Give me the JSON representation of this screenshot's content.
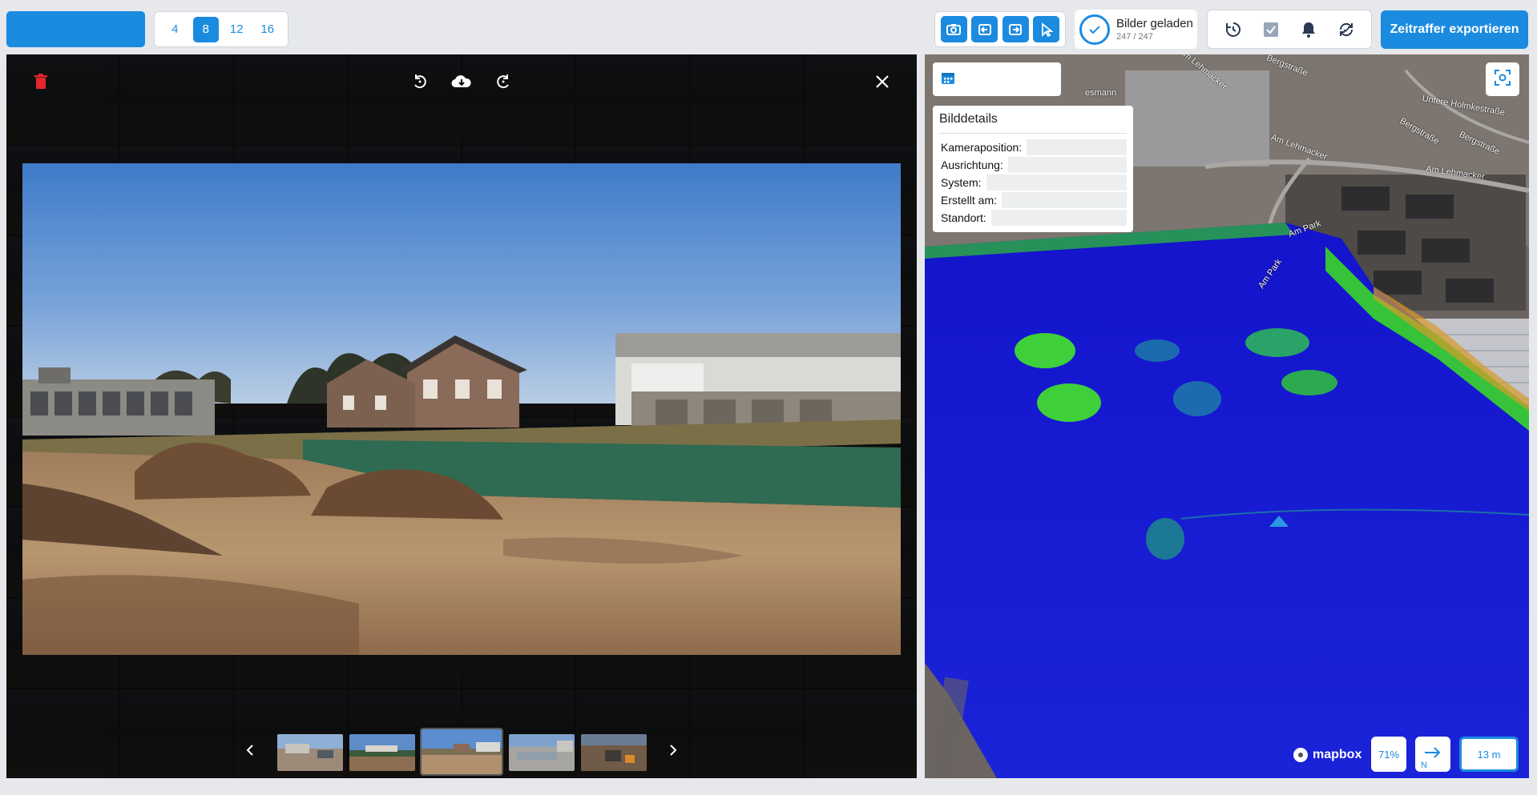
{
  "toolbar": {
    "grid_options": [
      "4",
      "8",
      "12",
      "16"
    ],
    "grid_selected": "8",
    "loaded": {
      "title": "Bilder geladen",
      "count": "247 / 247"
    },
    "export_label": "Zeitraffer exportieren",
    "accent_color": "#1b8be0"
  },
  "viewer": {
    "icons": [
      "trash-icon",
      "rotate-left-icon",
      "cloud-download-icon",
      "rotate-right-icon",
      "close-icon"
    ],
    "thumbnail_count": 5,
    "active_thumbnail_index": 2
  },
  "map": {
    "details": {
      "title": "Bilddetails",
      "rows": [
        {
          "label": "Kameraposition:"
        },
        {
          "label": "Ausrichtung:"
        },
        {
          "label": "System:"
        },
        {
          "label": "Erstellt am:"
        },
        {
          "label": "Standort:"
        }
      ]
    },
    "streets": [
      "Am Lehmacker",
      "Bergstraße",
      "Untere Holmkestraße",
      "Bergstraße",
      "Am Lehmacker",
      "Am Lehmacker",
      "Bergstraße",
      "Am Park",
      "Am Park",
      "esmann"
    ],
    "mapbox_label": "mapbox",
    "zoom_label": "71%",
    "compass_label": "N",
    "scale_label": "13 m"
  }
}
